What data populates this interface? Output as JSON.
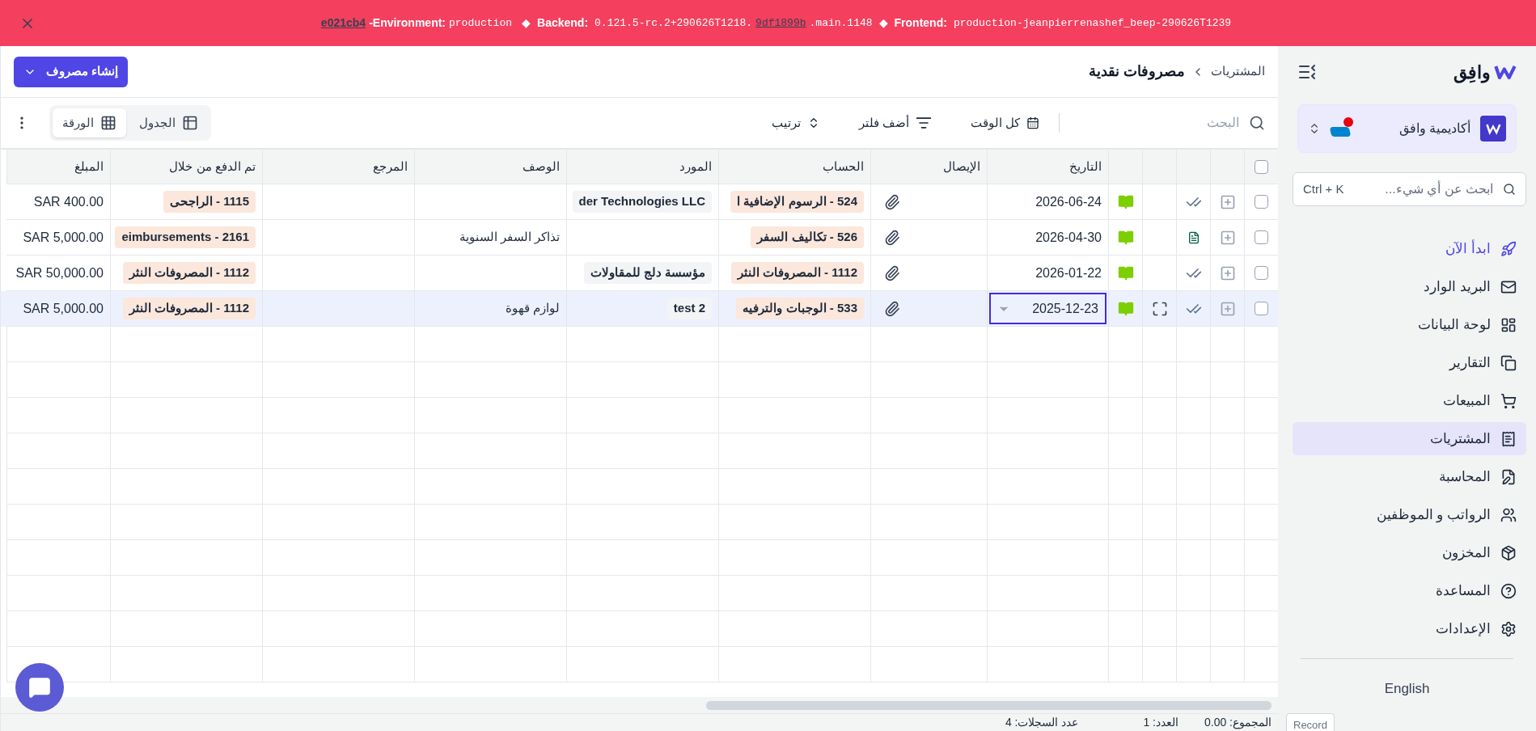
{
  "banner": {
    "commit": "e021cb4",
    "env_label": "-Environment:",
    "env": "production",
    "sep1": "◆",
    "backend_label": "Backend:",
    "backend_pre": "0.121.5-rc.2+290626T1218.",
    "backend_link": "9df1899b",
    "backend_post": ".main.1148",
    "sep2": "◆",
    "frontend_label": "Frontend:",
    "frontend": "production-jeanpierrenashef_beep-290626T1239"
  },
  "header": {
    "breadcrumb": "المشتريات",
    "title": "مصروفات نقدية",
    "create_button": "إنشاء مصروف"
  },
  "toolbar": {
    "search_placeholder": "البحث",
    "period": "كل الوقت",
    "filter": "أضف فلتر",
    "sort": "ترتيب",
    "views": [
      {
        "label": "الجدول",
        "selected": false
      },
      {
        "label": "الورقة",
        "selected": true
      }
    ]
  },
  "table": {
    "select_all_checked": false,
    "columns": [
      "التاريخ",
      "الإيصال",
      "الحساب",
      "المورد",
      "الوصف",
      "المرجع",
      "تم الدفع من خلال",
      "المبلغ"
    ],
    "rows": [
      {
        "checked": false,
        "selected": false,
        "kind": "check",
        "date": "2026-06-24",
        "account": "524 - الرسوم الإضافية ا",
        "vendor": "der Technologies LLC",
        "description": "",
        "reference": "",
        "paid_through": "1115 - الراجحى",
        "amount": "SAR 400.00"
      },
      {
        "checked": false,
        "selected": false,
        "kind": "document",
        "date": "2026-04-30",
        "account": "526 - تكاليف السفر",
        "vendor": "",
        "description": "تذاكر السفر السنوية",
        "reference": "",
        "paid_through": "2161 - eimbursements",
        "amount": "SAR 5,000.00"
      },
      {
        "checked": false,
        "selected": false,
        "kind": "check",
        "date": "2026-01-22",
        "account": "1112 - المصروفات النثر",
        "vendor": "مؤسسة دلج للمقاولات",
        "description": "",
        "reference": "",
        "paid_through": "1112 - المصروفات النثر",
        "amount": "SAR 50,000.00"
      },
      {
        "checked": false,
        "selected": true,
        "kind": "check",
        "date": "2025-12-23",
        "account": "533 - الوجبات والترفيه",
        "vendor": "test 2",
        "description": "لوازم قهوة",
        "reference": "",
        "paid_through": "1112 - المصروفات النثر",
        "amount": "SAR 5,000.00"
      }
    ]
  },
  "footer": {
    "total": "المجموع: 0.00",
    "count": "العدد: 1",
    "records": "عدد السجلات: 4"
  },
  "sidebar": {
    "logo": "وافِق",
    "org": "أكاديمية وافق",
    "search_placeholder": "ابحث عن أي شيء...",
    "shortcut": "Ctrl + K",
    "items": [
      {
        "label": "ابدأ الآن",
        "accent": true,
        "selected": false
      },
      {
        "label": "البريد الوارد",
        "accent": false,
        "selected": false
      },
      {
        "label": "لوحة البيانات",
        "accent": false,
        "selected": false
      },
      {
        "label": "التقارير",
        "accent": false,
        "selected": false
      },
      {
        "label": "المبيعات",
        "accent": false,
        "selected": false
      },
      {
        "label": "المشتريات",
        "accent": false,
        "selected": true
      },
      {
        "label": "المحاسبة",
        "accent": false,
        "selected": false
      },
      {
        "label": "الرواتب و الموظفين",
        "accent": false,
        "selected": false
      },
      {
        "label": "المخزون",
        "accent": false,
        "selected": false
      },
      {
        "label": "المساعدة",
        "accent": false,
        "selected": false
      },
      {
        "label": "الإعدادات",
        "accent": false,
        "selected": false
      }
    ],
    "language": "English",
    "record": "Record"
  }
}
